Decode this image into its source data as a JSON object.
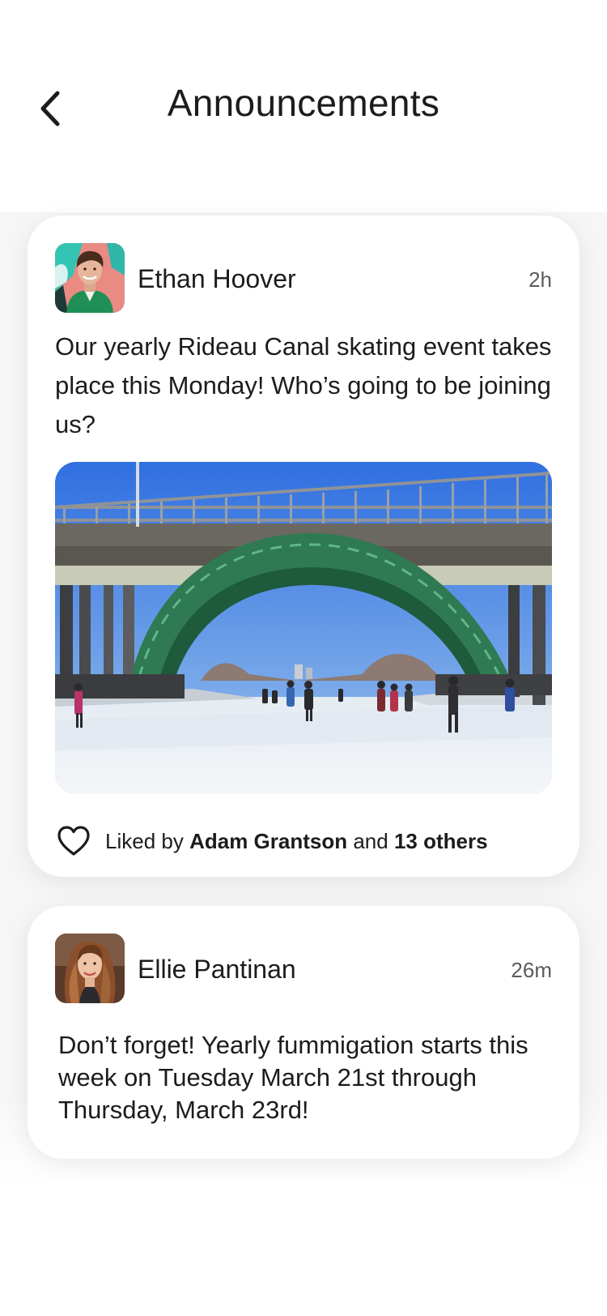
{
  "header": {
    "title": "Announcements",
    "back_icon": "chevron-left-icon"
  },
  "posts": [
    {
      "author": "Ethan Hoover",
      "time": "2h",
      "text": "Our yearly Rideau Canal skating event takes place this Monday! Who’s going to be joining us?",
      "image": "rideau-canal-skating-bridge-photo",
      "likes": {
        "prefix": "Liked by",
        "liker": "Adam Grantson",
        "joiner": "and",
        "others": "13 others",
        "icon": "heart-outline-icon"
      }
    },
    {
      "author": "Ellie Pantinan",
      "time": "26m",
      "text": "Don’t forget! Yearly fummigation starts this week on Tuesday March 21st through Thursday, March 23rd!"
    }
  ],
  "colors": {
    "text": "#1c1c1e",
    "muted": "#5b5b60",
    "background": "#f6f6f7",
    "card": "#ffffff"
  }
}
